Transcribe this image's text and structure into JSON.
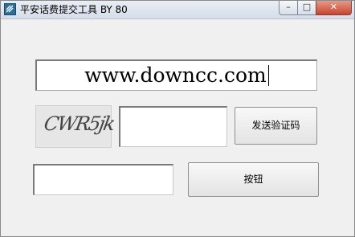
{
  "window": {
    "title": "平安话费提交工具  BY 80",
    "controls": {
      "minimize": "–",
      "maximize": "□",
      "close": "✕"
    }
  },
  "form": {
    "url_value": "www.downcc.com",
    "captcha_text": "CWR5jk",
    "code_value": "",
    "send_code_label": "发送验证码",
    "bottom_value": "",
    "submit_label": "按钮"
  }
}
